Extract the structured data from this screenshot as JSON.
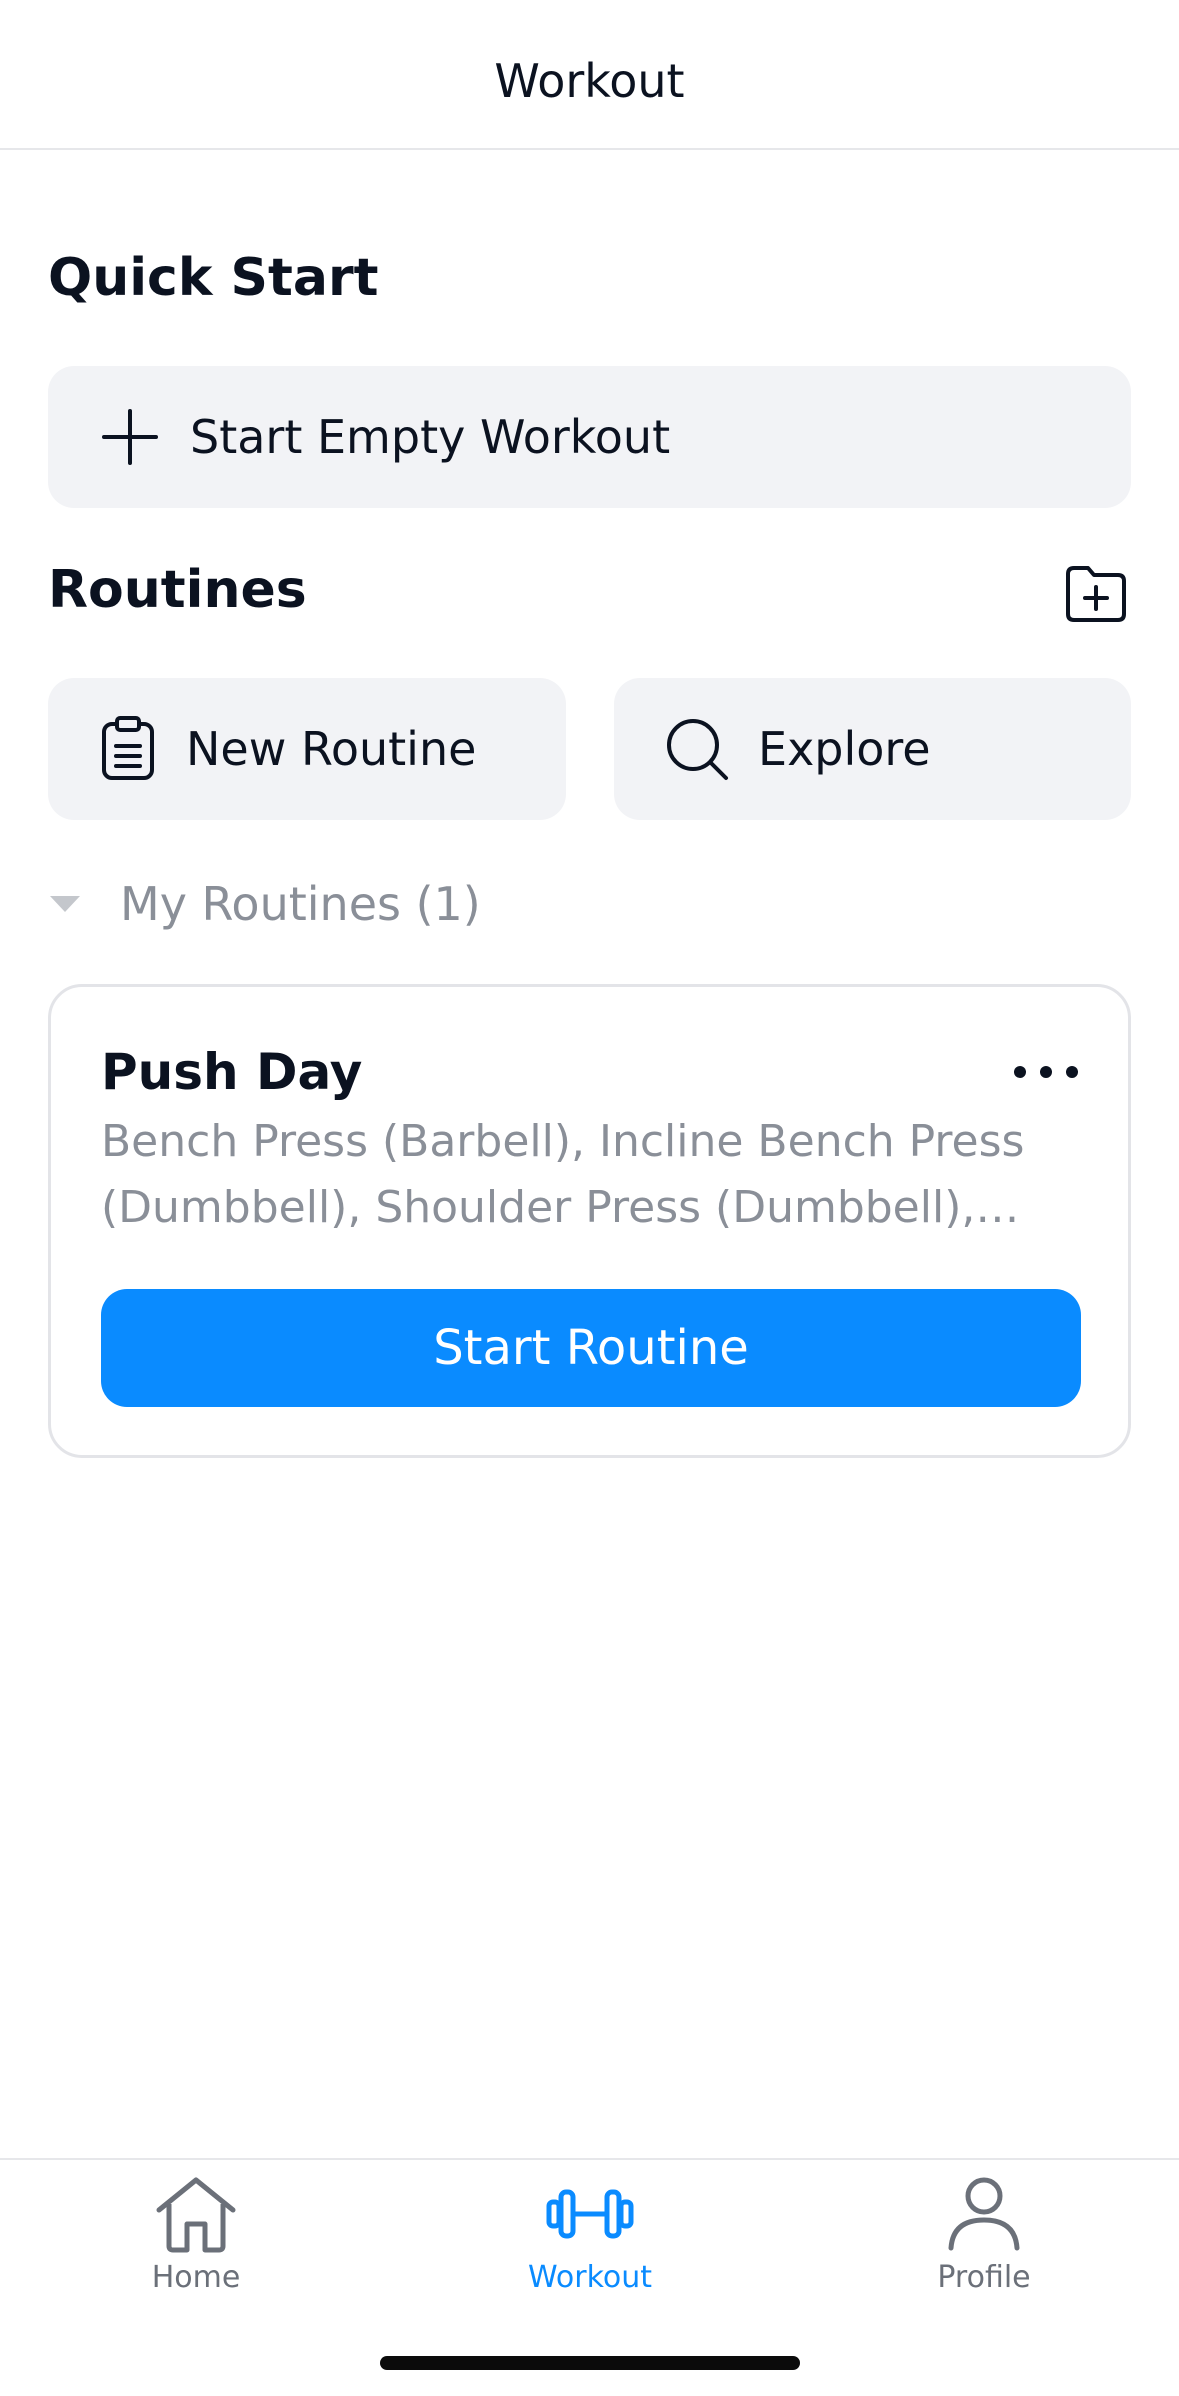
{
  "header": {
    "title": "Workout"
  },
  "quick_start": {
    "title": "Quick Start",
    "start_empty_label": "Start Empty Workout"
  },
  "routines": {
    "title": "Routines",
    "new_routine_label": "New Routine",
    "explore_label": "Explore",
    "folder_label": "My Routines (1)",
    "items": [
      {
        "name": "Push Day",
        "exercises": "Bench Press (Barbell), Incline Bench Press (Dumbbell), Shoulder Press (Dumbbell), Lateral Raise",
        "start_label": "Start Routine"
      }
    ]
  },
  "bottom_nav": {
    "items": [
      {
        "label": "Home",
        "active": false
      },
      {
        "label": "Workout",
        "active": true
      },
      {
        "label": "Profile",
        "active": false
      }
    ]
  },
  "colors": {
    "accent": "#0a8bff",
    "tile_bg": "#f2f3f6",
    "muted_text": "#8a8f98",
    "text": "#0b1220"
  }
}
